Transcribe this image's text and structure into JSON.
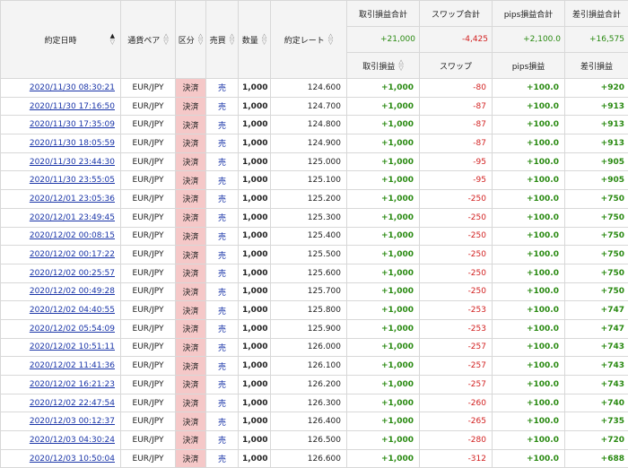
{
  "headers": {
    "date": "約定日時",
    "pair": "通貨ペア",
    "kubun": "区分",
    "bai": "売買",
    "qty": "数量",
    "rate": "約定レート",
    "pl_total": "取引損益合計",
    "swap_total": "スワップ合計",
    "pips_total": "pips損益合計",
    "net_total": "差引損益合計",
    "pl": "取引損益",
    "swap": "スワップ",
    "pips": "pips損益",
    "net": "差引損益"
  },
  "totals": {
    "pl": "+21,000",
    "swap": "-4,425",
    "pips": "+2,100.0",
    "net": "+16,575"
  },
  "colors": {
    "positive": "#2a8a12",
    "negative": "#d21f1f",
    "link": "#1a35a8",
    "settled_bg": "#f5c8c8"
  },
  "rows": [
    {
      "date": "2020/11/30 08:30:21",
      "pair": "EUR/JPY",
      "kubun": "決済",
      "bai": "売",
      "qty": "1,000",
      "rate": "124.600",
      "pl": "+1,000",
      "swap": "-80",
      "pips": "+100.0",
      "net": "+920"
    },
    {
      "date": "2020/11/30 17:16:50",
      "pair": "EUR/JPY",
      "kubun": "決済",
      "bai": "売",
      "qty": "1,000",
      "rate": "124.700",
      "pl": "+1,000",
      "swap": "-87",
      "pips": "+100.0",
      "net": "+913"
    },
    {
      "date": "2020/11/30 17:35:09",
      "pair": "EUR/JPY",
      "kubun": "決済",
      "bai": "売",
      "qty": "1,000",
      "rate": "124.800",
      "pl": "+1,000",
      "swap": "-87",
      "pips": "+100.0",
      "net": "+913"
    },
    {
      "date": "2020/11/30 18:05:59",
      "pair": "EUR/JPY",
      "kubun": "決済",
      "bai": "売",
      "qty": "1,000",
      "rate": "124.900",
      "pl": "+1,000",
      "swap": "-87",
      "pips": "+100.0",
      "net": "+913"
    },
    {
      "date": "2020/11/30 23:44:30",
      "pair": "EUR/JPY",
      "kubun": "決済",
      "bai": "売",
      "qty": "1,000",
      "rate": "125.000",
      "pl": "+1,000",
      "swap": "-95",
      "pips": "+100.0",
      "net": "+905"
    },
    {
      "date": "2020/11/30 23:55:05",
      "pair": "EUR/JPY",
      "kubun": "決済",
      "bai": "売",
      "qty": "1,000",
      "rate": "125.100",
      "pl": "+1,000",
      "swap": "-95",
      "pips": "+100.0",
      "net": "+905"
    },
    {
      "date": "2020/12/01 23:05:36",
      "pair": "EUR/JPY",
      "kubun": "決済",
      "bai": "売",
      "qty": "1,000",
      "rate": "125.200",
      "pl": "+1,000",
      "swap": "-250",
      "pips": "+100.0",
      "net": "+750"
    },
    {
      "date": "2020/12/01 23:49:45",
      "pair": "EUR/JPY",
      "kubun": "決済",
      "bai": "売",
      "qty": "1,000",
      "rate": "125.300",
      "pl": "+1,000",
      "swap": "-250",
      "pips": "+100.0",
      "net": "+750"
    },
    {
      "date": "2020/12/02 00:08:15",
      "pair": "EUR/JPY",
      "kubun": "決済",
      "bai": "売",
      "qty": "1,000",
      "rate": "125.400",
      "pl": "+1,000",
      "swap": "-250",
      "pips": "+100.0",
      "net": "+750"
    },
    {
      "date": "2020/12/02 00:17:22",
      "pair": "EUR/JPY",
      "kubun": "決済",
      "bai": "売",
      "qty": "1,000",
      "rate": "125.500",
      "pl": "+1,000",
      "swap": "-250",
      "pips": "+100.0",
      "net": "+750"
    },
    {
      "date": "2020/12/02 00:25:57",
      "pair": "EUR/JPY",
      "kubun": "決済",
      "bai": "売",
      "qty": "1,000",
      "rate": "125.600",
      "pl": "+1,000",
      "swap": "-250",
      "pips": "+100.0",
      "net": "+750"
    },
    {
      "date": "2020/12/02 00:49:28",
      "pair": "EUR/JPY",
      "kubun": "決済",
      "bai": "売",
      "qty": "1,000",
      "rate": "125.700",
      "pl": "+1,000",
      "swap": "-250",
      "pips": "+100.0",
      "net": "+750"
    },
    {
      "date": "2020/12/02 04:40:55",
      "pair": "EUR/JPY",
      "kubun": "決済",
      "bai": "売",
      "qty": "1,000",
      "rate": "125.800",
      "pl": "+1,000",
      "swap": "-253",
      "pips": "+100.0",
      "net": "+747"
    },
    {
      "date": "2020/12/02 05:54:09",
      "pair": "EUR/JPY",
      "kubun": "決済",
      "bai": "売",
      "qty": "1,000",
      "rate": "125.900",
      "pl": "+1,000",
      "swap": "-253",
      "pips": "+100.0",
      "net": "+747"
    },
    {
      "date": "2020/12/02 10:51:11",
      "pair": "EUR/JPY",
      "kubun": "決済",
      "bai": "売",
      "qty": "1,000",
      "rate": "126.000",
      "pl": "+1,000",
      "swap": "-257",
      "pips": "+100.0",
      "net": "+743"
    },
    {
      "date": "2020/12/02 11:41:36",
      "pair": "EUR/JPY",
      "kubun": "決済",
      "bai": "売",
      "qty": "1,000",
      "rate": "126.100",
      "pl": "+1,000",
      "swap": "-257",
      "pips": "+100.0",
      "net": "+743"
    },
    {
      "date": "2020/12/02 16:21:23",
      "pair": "EUR/JPY",
      "kubun": "決済",
      "bai": "売",
      "qty": "1,000",
      "rate": "126.200",
      "pl": "+1,000",
      "swap": "-257",
      "pips": "+100.0",
      "net": "+743"
    },
    {
      "date": "2020/12/02 22:47:54",
      "pair": "EUR/JPY",
      "kubun": "決済",
      "bai": "売",
      "qty": "1,000",
      "rate": "126.300",
      "pl": "+1,000",
      "swap": "-260",
      "pips": "+100.0",
      "net": "+740"
    },
    {
      "date": "2020/12/03 00:12:37",
      "pair": "EUR/JPY",
      "kubun": "決済",
      "bai": "売",
      "qty": "1,000",
      "rate": "126.400",
      "pl": "+1,000",
      "swap": "-265",
      "pips": "+100.0",
      "net": "+735"
    },
    {
      "date": "2020/12/03 04:30:24",
      "pair": "EUR/JPY",
      "kubun": "決済",
      "bai": "売",
      "qty": "1,000",
      "rate": "126.500",
      "pl": "+1,000",
      "swap": "-280",
      "pips": "+100.0",
      "net": "+720"
    },
    {
      "date": "2020/12/03 10:50:04",
      "pair": "EUR/JPY",
      "kubun": "決済",
      "bai": "売",
      "qty": "1,000",
      "rate": "126.600",
      "pl": "+1,000",
      "swap": "-312",
      "pips": "+100.0",
      "net": "+688"
    }
  ]
}
